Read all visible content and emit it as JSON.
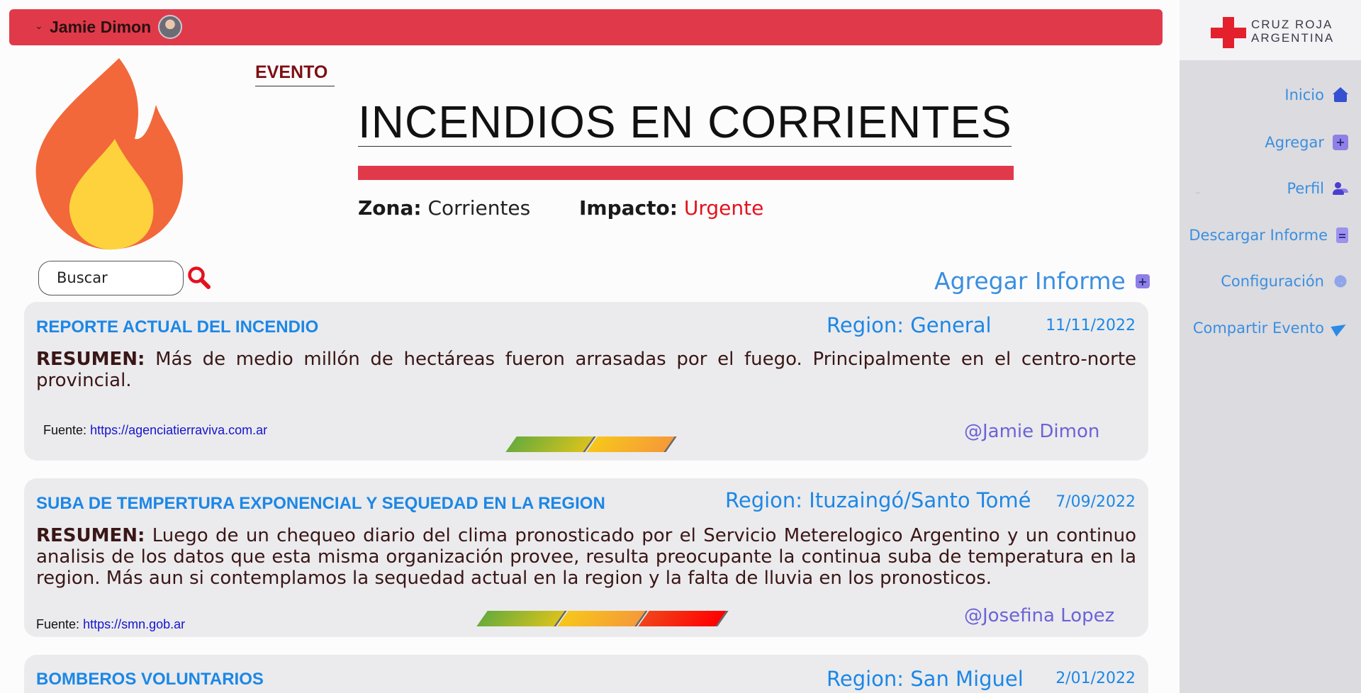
{
  "topbar": {
    "user_name": "Jamie Dimon"
  },
  "sidebar": {
    "logo_line1": "CRUZ ROJA",
    "logo_line2": "ARGENTINA",
    "items": [
      {
        "label": "Inicio",
        "icon": "home-icon"
      },
      {
        "label": "Agregar",
        "icon": "plus-square-icon"
      },
      {
        "label": "Perfil",
        "icon": "users-icon"
      },
      {
        "label": "Descargar Informe",
        "icon": "document-icon"
      },
      {
        "label": "Configuración",
        "icon": "gear-icon"
      },
      {
        "label": "Compartir Evento",
        "icon": "send-icon"
      }
    ]
  },
  "event": {
    "tag": "EVENTO",
    "title": "INCENDIOS EN CORRIENTES",
    "zone_label": "Zona:",
    "zone_value": "Corrientes",
    "impact_label": "Impacto:",
    "impact_value": "Urgente"
  },
  "search": {
    "placeholder": "Buscar"
  },
  "add_report_label": "Agregar Informe",
  "reports": [
    {
      "title": "REPORTE ACTUAL DEL  INCENDIO",
      "region": "Region: General",
      "date": "11/11/2022",
      "summary_label": "RESUMEN:",
      "summary": "Más de medio millón de hectáreas fueron arrasadas por el fuego. Principalmente en el centro-norte provincial.",
      "source_label": "Fuente:",
      "source_url": "https://agenciatierraviva.com.ar",
      "author": "@Jamie Dimon",
      "impact_level": 2
    },
    {
      "title": "SUBA DE TEMPERTURA EXPONENCIAL Y SEQUEDAD EN LA REGION",
      "region": "Region: Ituzaingó/Santo Tomé",
      "date": "7/09/2022",
      "summary_label": "RESUMEN:",
      "summary": "Luego de un chequeo diario del clima pronosticado por el Servicio Meterelogico Argentino y un continuo analisis de los datos que esta misma organización provee, resulta preocupante la continua suba de temperatura en la region. Más aun si contemplamos la sequedad actual en la region y la falta de lluvia en los pronosticos.",
      "source_label": "Fuente:",
      "source_url": "https://smn.gob.ar",
      "author": "@Josefina Lopez",
      "impact_level": 3
    },
    {
      "title": "BOMBEROS VOLUNTARIOS",
      "region": "Region: San Miguel",
      "date": "2/01/2022"
    }
  ],
  "colors": {
    "brand_red": "#e03a4a",
    "link_blue": "#1c87e6",
    "author_purple": "#6b63d8",
    "urgent": "#e4111d"
  }
}
